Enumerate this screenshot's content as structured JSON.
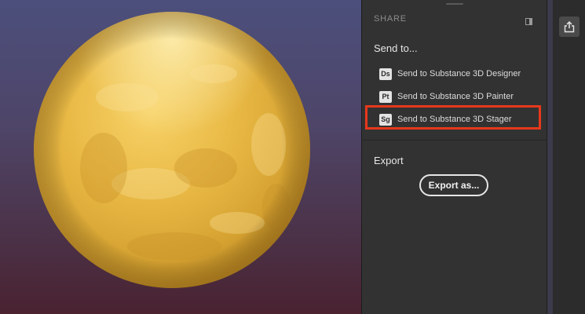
{
  "viewport": {
    "object": "material-preview-sphere",
    "background_top": "#4c4f7c",
    "background_bottom": "#4a2230",
    "material_color": "#e5b23f"
  },
  "share_panel": {
    "header": "SHARE",
    "send_to_title": "Send to...",
    "send_items": [
      {
        "badge": "Ds",
        "label": "Send to Substance 3D Designer"
      },
      {
        "badge": "Pt",
        "label": "Send to Substance 3D Painter"
      },
      {
        "badge": "Sg",
        "label": "Send to Substance 3D Stager",
        "highlighted": true
      }
    ],
    "export_title": "Export",
    "export_button": "Export as...",
    "panel_color": "#323232",
    "highlight_color": "#e8381c"
  },
  "toolbar": {
    "share_icon": "share-export-icon"
  }
}
